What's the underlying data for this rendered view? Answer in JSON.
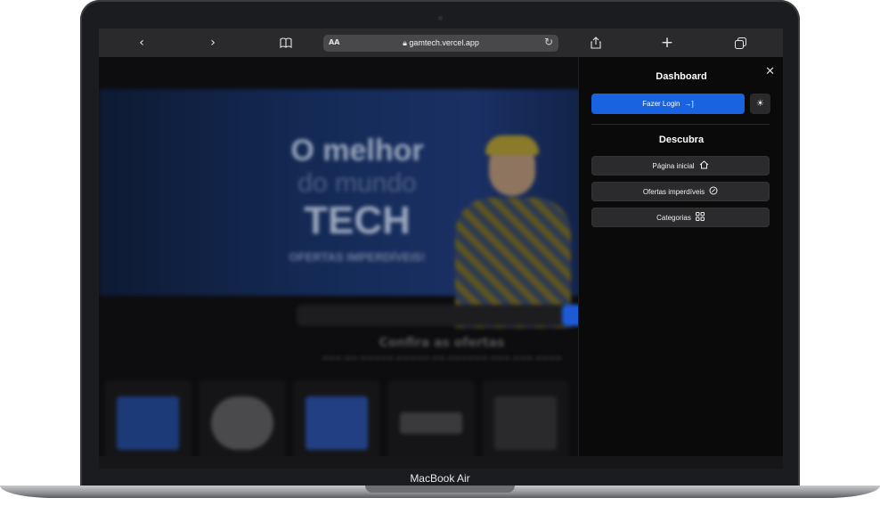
{
  "browser": {
    "text_size_label": "AA",
    "url": "gamtech.vercel.app",
    "icons": [
      "back-icon",
      "forward-icon",
      "bookmarks-icon",
      "reload-icon",
      "share-icon",
      "new-tab-icon",
      "tabs-icon"
    ]
  },
  "page": {
    "hero": {
      "line1": "O melhor",
      "line2": "do mundo",
      "line3": "TECH",
      "line4": "OFERTAS IMPERDÍVEIS!"
    },
    "section_title": "Confira as ofertas"
  },
  "drawer": {
    "title": "Dashboard",
    "login_label": "Fazer Login",
    "section_heading": "Descubra",
    "items": [
      {
        "label": "Página inicial",
        "icon": "home-icon"
      },
      {
        "label": "Ofertas imperdíveis",
        "icon": "percent-badge-icon"
      },
      {
        "label": "Categorias",
        "icon": "grid-icon"
      }
    ]
  },
  "device": {
    "model_label": "MacBook Air"
  },
  "colors": {
    "accent": "#1a63e0",
    "drawer_bg": "#0a0a0a",
    "toolbar_bg": "#2a2a2c"
  }
}
